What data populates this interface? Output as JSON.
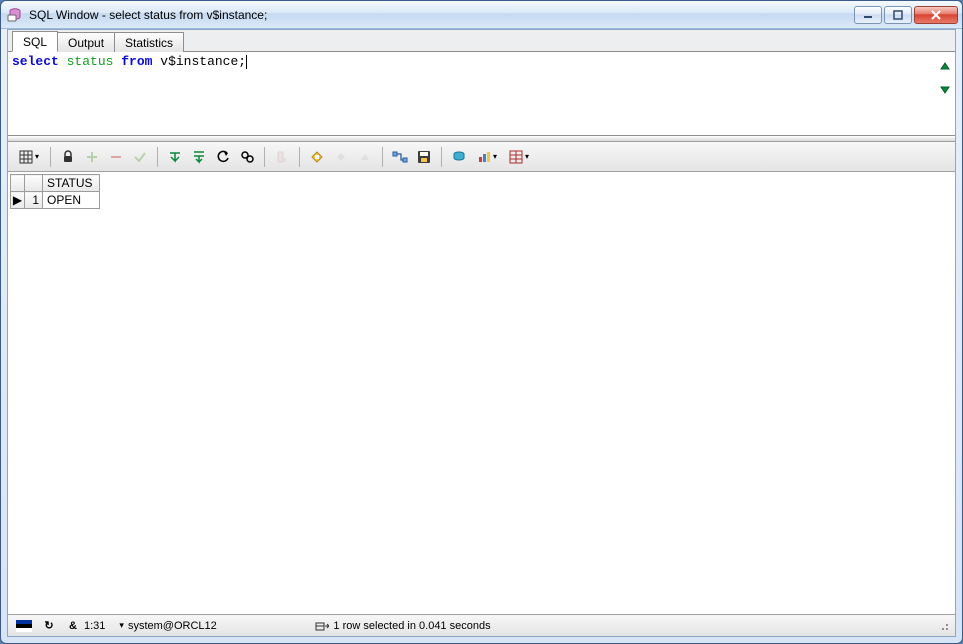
{
  "window": {
    "title": "SQL Window - select status from v$instance;"
  },
  "tabs": [
    {
      "label": "SQL",
      "active": true
    },
    {
      "label": "Output",
      "active": false
    },
    {
      "label": "Statistics",
      "active": false
    }
  ],
  "editor": {
    "tokens": [
      {
        "text": "select",
        "cls": "kw"
      },
      {
        "text": " ",
        "cls": "plain"
      },
      {
        "text": "status",
        "cls": "ident"
      },
      {
        "text": " ",
        "cls": "plain"
      },
      {
        "text": "from",
        "cls": "kw"
      },
      {
        "text": " v$instance;",
        "cls": "plain"
      }
    ]
  },
  "grid": {
    "columns": [
      "STATUS"
    ],
    "rows": [
      {
        "n": "1",
        "cells": [
          "OPEN"
        ]
      }
    ]
  },
  "statusbar": {
    "flag_colors": [
      "#0033a0",
      "#000000",
      "#ffffff"
    ],
    "refresh_icon": "↻",
    "user_icon": "&",
    "cursor_pos": "1:31",
    "connection": "system@ORCL12",
    "message": "1 row selected in 0.041 seconds"
  },
  "icons": {
    "tri_down": "▾"
  }
}
